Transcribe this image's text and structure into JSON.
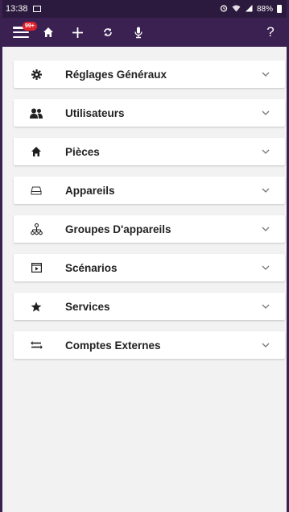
{
  "status_bar": {
    "time": "13:38",
    "battery": "88%",
    "icons": [
      "image-icon",
      "alarm-icon",
      "wifi-icon",
      "signal-icon",
      "battery-icon"
    ]
  },
  "toolbar": {
    "badge": "99+",
    "help": "?",
    "icons": [
      "menu-icon",
      "home-icon",
      "plus-icon",
      "sync-icon",
      "microphone-icon",
      "help-icon"
    ]
  },
  "colors": {
    "toolbar_bg": "#3b2052",
    "status_bg": "#2b1a3d",
    "badge": "#e0212b",
    "content_bg": "#f2f2f2"
  },
  "menu": {
    "items": [
      {
        "label": "Réglages Généraux",
        "icon": "gear-icon"
      },
      {
        "label": "Utilisateurs",
        "icon": "users-icon"
      },
      {
        "label": "Pièces",
        "icon": "home-icon"
      },
      {
        "label": "Appareils",
        "icon": "device-icon"
      },
      {
        "label": "Groupes D'appareils",
        "icon": "device-group-icon"
      },
      {
        "label": "Scénarios",
        "icon": "scenario-icon"
      },
      {
        "label": "Services",
        "icon": "star-icon"
      },
      {
        "label": "Comptes Externes",
        "icon": "external-accounts-icon"
      }
    ]
  }
}
